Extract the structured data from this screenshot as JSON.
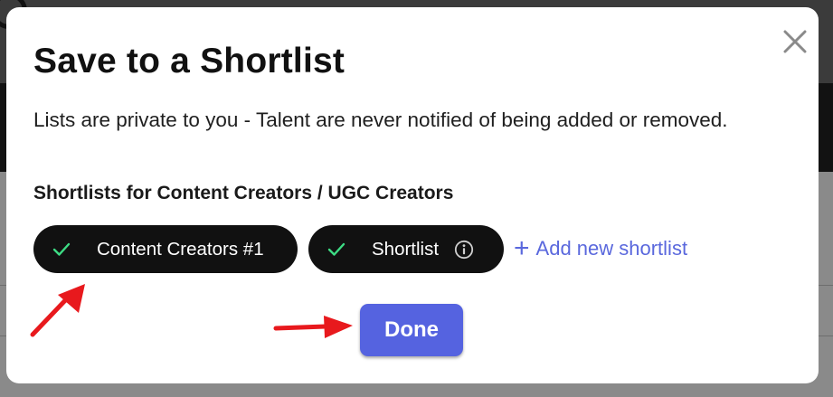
{
  "modal": {
    "title": "Save to a Shortlist",
    "description": "Lists are private to you - Talent are never notified of being added or removed.",
    "section_title": "Shortlists for Content Creators / UGC Creators",
    "shortlists": [
      {
        "label": "Content Creators #1",
        "selected": true,
        "icon": "check-icon"
      },
      {
        "label": "Shortlist",
        "selected": true,
        "icon": "check-icon",
        "trailing_icon": "info-icon"
      }
    ],
    "add_link": {
      "icon": "plus-icon",
      "label": "Add new shortlist"
    },
    "done_label": "Done",
    "close_icon": "close-icon"
  },
  "colors": {
    "accent": "#5563e0",
    "link": "#5a68dd",
    "chip_bg": "#111111",
    "check": "#3ddc84",
    "annotation_arrow": "#e8191d"
  }
}
